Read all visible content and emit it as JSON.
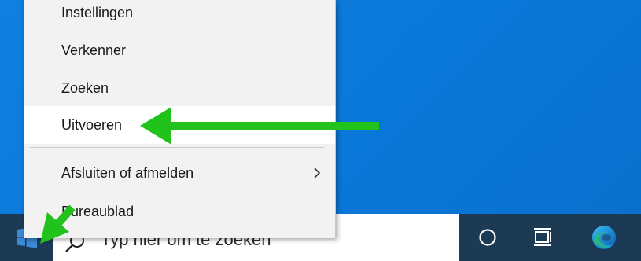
{
  "context_menu": {
    "items": [
      {
        "label": "Instellingen"
      },
      {
        "label": "Verkenner"
      },
      {
        "label": "Zoeken"
      },
      {
        "label": "Uitvoeren"
      },
      {
        "label": "Afsluiten of afmelden"
      },
      {
        "label": "Bureaublad"
      }
    ],
    "highlighted_item": "Uitvoeren"
  },
  "taskbar": {
    "search": {
      "placeholder": "Typ hier om te zoeken"
    },
    "icons": [
      "windows-start-icon",
      "cortana-icon",
      "task-view-icon",
      "edge-icon"
    ]
  },
  "annotations": {
    "arrow_color": "#22c21c"
  },
  "colors": {
    "desktop": "#0a78d9",
    "taskbar": "#1d3a55",
    "menu_bg": "#f2f2f2",
    "highlight_bg": "#ffffff"
  }
}
